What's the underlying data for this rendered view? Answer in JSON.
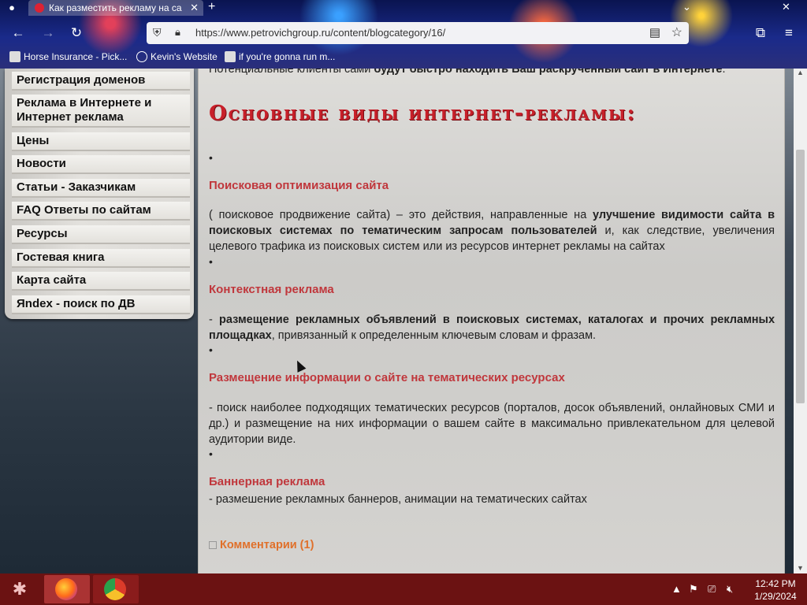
{
  "browser": {
    "tab_title": "Как разместить рекламу на са",
    "url": "https://www.petrovichgroup.ru/content/blogcategory/16/",
    "bookmarks": [
      "Horse Insurance - Pick...",
      "Kevin's Website",
      "if you're gonna run m..."
    ]
  },
  "sidebar": {
    "items": [
      {
        "label": "Регистрация доменов"
      },
      {
        "label": "Реклама в Интернете и Интернет реклама"
      },
      {
        "label": "Цены"
      },
      {
        "label": "Новости"
      },
      {
        "label": "Статьи - Заказчикам"
      },
      {
        "label": "FAQ Ответы по сайтам"
      },
      {
        "label": "Ресурсы"
      },
      {
        "label": "Гостевая книга"
      },
      {
        "label": "Карта сайта"
      },
      {
        "label": "Яndex - поиск по ДВ"
      }
    ]
  },
  "content": {
    "intro_prefix": "Потенциальные клиенты сами ",
    "intro_bold": "будут быстро находить Ваш раскрученный сайт в Интернете",
    "intro_suffix": ".",
    "heading": "Основные виды интернет-рекламы:",
    "bullet": "•",
    "sections": [
      {
        "title": "Поисковая оптимизация сайта",
        "text_prefix": "( поисковое продвижение сайта) – это действия, направленные на ",
        "text_bold": "улучшение видимости сайта в поисковых системах по тематическим запросам пользователей",
        "text_suffix": " и, как следствие, увеличения целевого трафика из поисковых систем или из ресурсов интернет рекламы на сайтах"
      },
      {
        "title": "Контекстная реклама",
        "text_prefix": "- ",
        "text_bold": "размещение рекламных объявлений в поисковых системах, каталогах и прочих рекламных площадках",
        "text_suffix": ", привязанный к определенным ключевым словам и фразам."
      },
      {
        "title": "Размещение информации о сайте на тематических ресурсах",
        "text_prefix": "- поиск наиболее подходящих тематических ресурсов (порталов, досок объявлений, онлайновых СМИ и др.) и размещение на них информации о вашем сайте в максимально привлекательном для целевой аудитории виде.",
        "text_bold": "",
        "text_suffix": ""
      },
      {
        "title": "Баннерная реклама",
        "text_prefix": "- размешение рекламных баннеров, анимации на тематических сайтах",
        "text_bold": "",
        "text_suffix": ""
      }
    ],
    "comments": "Комментарии (1)"
  },
  "taskbar": {
    "time": "12:42 PM",
    "date": "1/29/2024"
  }
}
